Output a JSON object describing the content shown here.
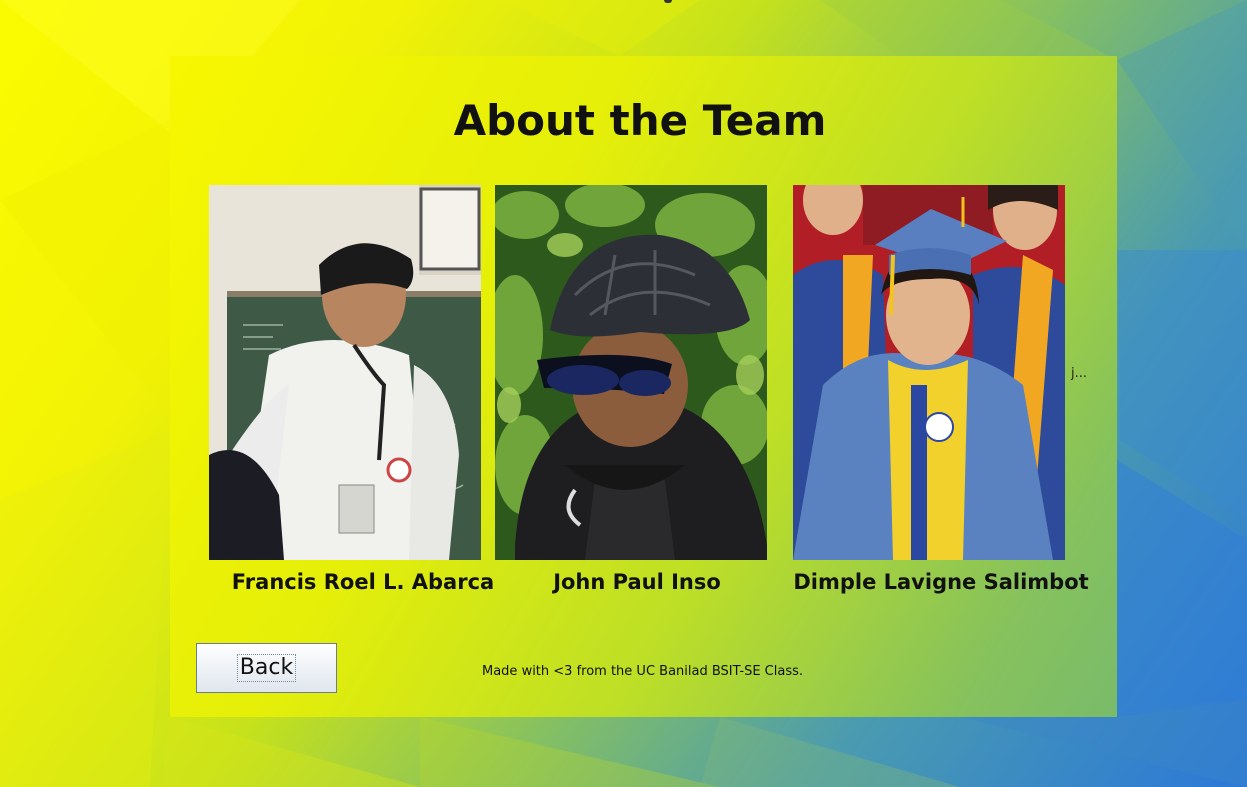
{
  "page": {
    "title": "About the Team",
    "credit": "Made with <3 from the UC Banilad BSIT-SE Class.",
    "back_label": "Back",
    "truncated_label": "j..."
  },
  "team": [
    {
      "name": "Francis Roel L. Abarca"
    },
    {
      "name": "John Paul Inso"
    },
    {
      "name": "Dimple Lavigne Salimbot"
    }
  ],
  "colors": {
    "background_start": "#fbfb00",
    "background_end": "#2b78d8",
    "text": "#111111"
  }
}
